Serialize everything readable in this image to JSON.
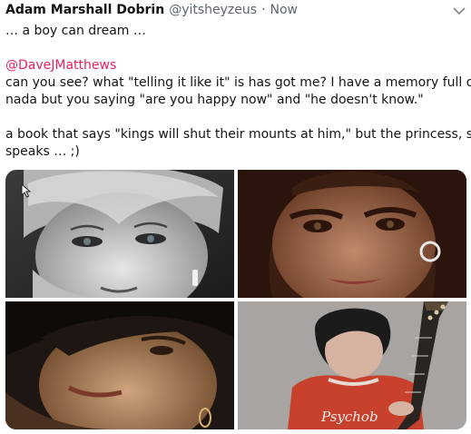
{
  "tweet": {
    "display_name": "Adam Marshall Dobrin",
    "handle": "@yitsheyzeus",
    "separator": "·",
    "timestamp": "Now",
    "menu_icon": "chevron-down-icon",
    "lines": [
      "… a boy can dream …",
      "",
      "",
      " can you see?  what \"telling it like it\" is has got me?  I have a memory full of",
      "nada but you saying \"are you happy now\" and \"he doesn't know.\"",
      "",
      "a book that says \"kings will shut their mounts at him,\" but the princess, she",
      "speaks … ;)"
    ],
    "mention": "@DaveJMatthews",
    "photos": [
      {
        "tone": "grayscale"
      },
      {
        "tone": "warm"
      },
      {
        "tone": "sepia"
      },
      {
        "tone": "red-shirt-guitar",
        "shirt_text": "Psychobilly"
      }
    ],
    "colors": {
      "mention": "#e0245e",
      "secondary_text": "#5b6670"
    }
  }
}
